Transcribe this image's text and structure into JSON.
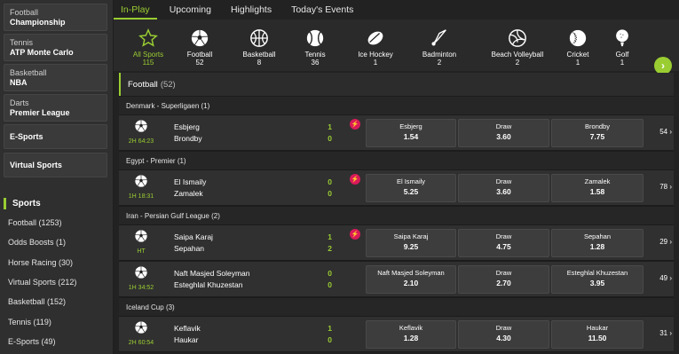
{
  "sidebar": {
    "cards": [
      {
        "line1": "Football",
        "line2": "Championship"
      },
      {
        "line1": "Tennis",
        "line2": "ATP Monte Carlo"
      },
      {
        "line1": "Basketball",
        "line2": "NBA"
      },
      {
        "line1": "Darts",
        "line2": "Premier League"
      },
      {
        "line1": "",
        "line2": "E-Sports"
      },
      {
        "line1": "",
        "line2": "Virtual Sports"
      }
    ],
    "sports_title": "Sports",
    "sports": [
      "Football (1253)",
      "Odds Boosts (1)",
      "Horse Racing (30)",
      "Virtual Sports (212)",
      "Basketball (152)",
      "Tennis (119)",
      "E-Sports (49)"
    ]
  },
  "tabs": [
    "In-Play",
    "Upcoming",
    "Highlights",
    "Today's Events"
  ],
  "sports_bar": [
    {
      "label": "All Sports",
      "count": "115",
      "icon": "star-icon"
    },
    {
      "label": "Football",
      "count": "52",
      "icon": "football-icon"
    },
    {
      "label": "Basketball",
      "count": "8",
      "icon": "basketball-icon"
    },
    {
      "label": "Tennis",
      "count": "36",
      "icon": "tennis-icon"
    },
    {
      "label": "Ice Hockey",
      "count": "1",
      "icon": "ice-hockey-icon"
    },
    {
      "label": "Badminton",
      "count": "2",
      "icon": "badminton-icon"
    },
    {
      "label": "Beach Volleyball",
      "count": "2",
      "icon": "volleyball-icon"
    },
    {
      "label": "Cricket",
      "count": "1",
      "icon": "cricket-icon"
    },
    {
      "label": "Golf",
      "count": "1",
      "icon": "golf-icon"
    }
  ],
  "section": {
    "title": "Football",
    "count": "(52)"
  },
  "leagues": [
    {
      "name": "Denmark - Superligaen",
      "count": "(1)"
    },
    {
      "name": "Egypt - Premier",
      "count": "(1)"
    },
    {
      "name": "Iran - Persian Gulf League",
      "count": "(2)"
    },
    {
      "name": "Iceland Cup",
      "count": "(3)"
    }
  ],
  "matches": [
    {
      "time": "2H 64:23",
      "home": "Esbjerg",
      "away": "Brondby",
      "hs": "1",
      "as": "0",
      "live": true,
      "o1": {
        "l": "Esbjerg",
        "v": "1.54"
      },
      "ox": {
        "l": "Draw",
        "v": "3.60"
      },
      "o2": {
        "l": "Brondby",
        "v": "7.75"
      },
      "more": "54"
    },
    {
      "time": "1H 18:31",
      "home": "El Ismaily",
      "away": "Zamalek",
      "hs": "0",
      "as": "0",
      "live": true,
      "o1": {
        "l": "El Ismaily",
        "v": "5.25"
      },
      "ox": {
        "l": "Draw",
        "v": "3.60"
      },
      "o2": {
        "l": "Zamalek",
        "v": "1.58"
      },
      "more": "78"
    },
    {
      "time": "HT",
      "home": "Saipa Karaj",
      "away": "Sepahan",
      "hs": "1",
      "as": "2",
      "live": true,
      "o1": {
        "l": "Saipa Karaj",
        "v": "9.25"
      },
      "ox": {
        "l": "Draw",
        "v": "4.75"
      },
      "o2": {
        "l": "Sepahan",
        "v": "1.28"
      },
      "more": "29"
    },
    {
      "time": "1H 34:52",
      "home": "Naft Masjed Soleyman",
      "away": "Esteghlal Khuzestan",
      "hs": "0",
      "as": "0",
      "live": false,
      "o1": {
        "l": "Naft Masjed Soleyman",
        "v": "2.10"
      },
      "ox": {
        "l": "Draw",
        "v": "2.70"
      },
      "o2": {
        "l": "Esteghlal Khuzestan",
        "v": "3.95"
      },
      "more": "49"
    },
    {
      "time": "2H 60:54",
      "home": "Keflavik",
      "away": "Haukar",
      "hs": "1",
      "as": "0",
      "live": false,
      "o1": {
        "l": "Keflavik",
        "v": "1.28"
      },
      "ox": {
        "l": "Draw",
        "v": "4.30"
      },
      "o2": {
        "l": "Haukar",
        "v": "11.50"
      },
      "more": "31"
    }
  ],
  "live_badge_glyph": "⚡",
  "colors": {
    "accent": "#9acd32",
    "live": "#d91a5a"
  }
}
